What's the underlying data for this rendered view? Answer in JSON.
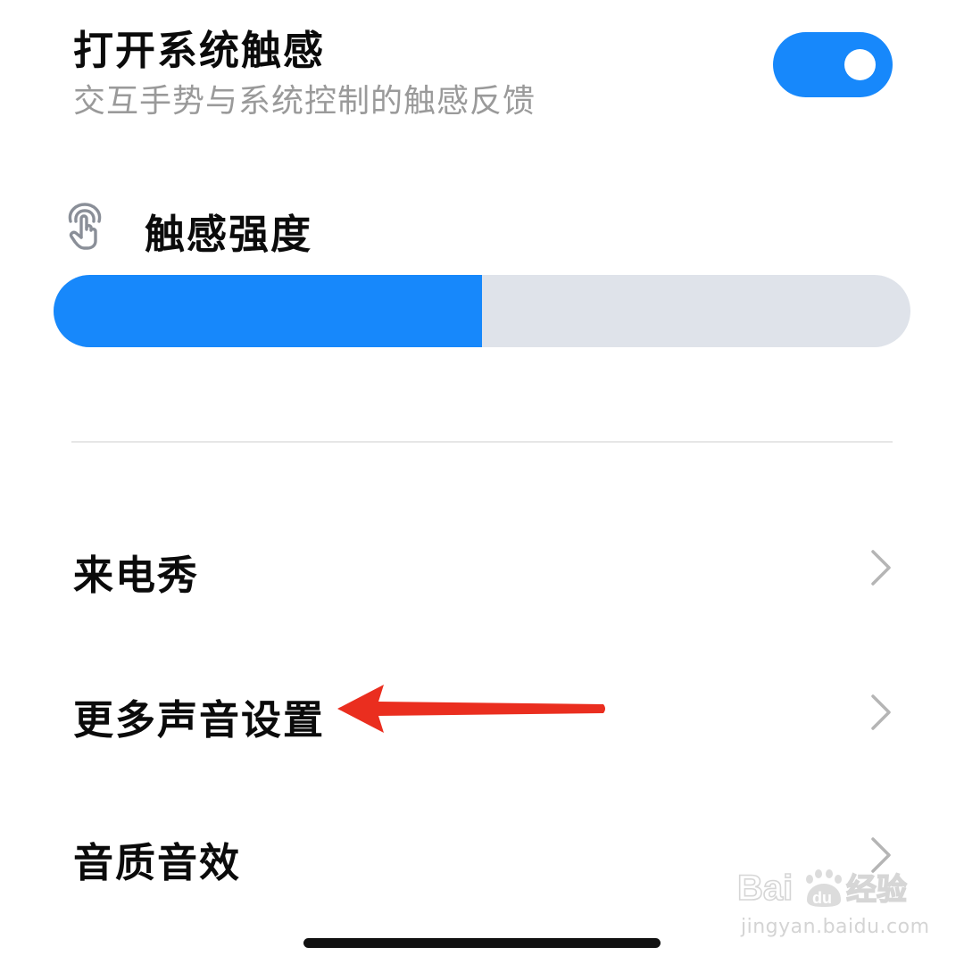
{
  "colors": {
    "accent": "#1788fb",
    "track": "#dfe3ea",
    "chevron": "#b5b5b5",
    "annotation": "#ea2e1f"
  },
  "system_haptics": {
    "title": "打开系统触感",
    "subtitle": "交互手势与系统控制的触感反馈",
    "enabled": true
  },
  "haptic_strength": {
    "icon": "finger-tap-icon",
    "label": "触感强度",
    "value_fraction": 0.5
  },
  "list": [
    {
      "label": "来电秀",
      "icon": "chevron-right-icon"
    },
    {
      "label": "更多声音设置",
      "icon": "chevron-right-icon"
    },
    {
      "label": "音质音效",
      "icon": "chevron-right-icon"
    }
  ],
  "annotation": {
    "icon": "red-arrow-icon",
    "points_to": 1
  },
  "watermark": {
    "logo_text": "Baidu经验",
    "url": "jingyan.baidu.com"
  }
}
